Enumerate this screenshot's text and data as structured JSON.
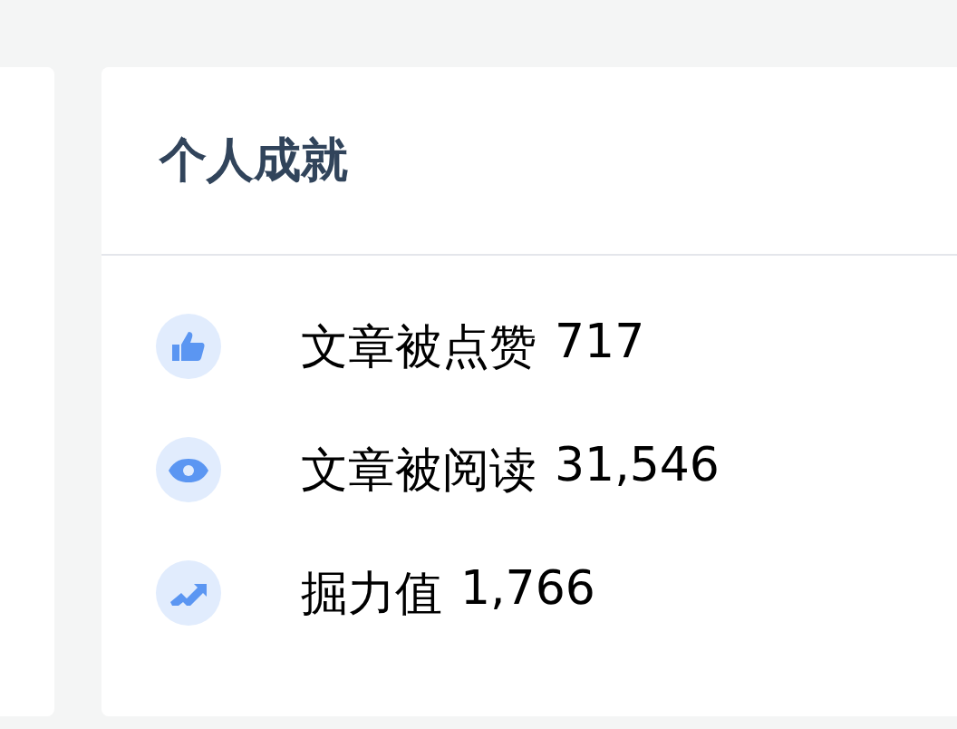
{
  "card": {
    "title": "个人成就"
  },
  "stats": [
    {
      "kind": "like",
      "label": "文章被点赞",
      "value": "717"
    },
    {
      "kind": "view",
      "label": "文章被阅读",
      "value": "31,546"
    },
    {
      "kind": "power",
      "label": "掘力值",
      "value": "1,766"
    }
  ]
}
